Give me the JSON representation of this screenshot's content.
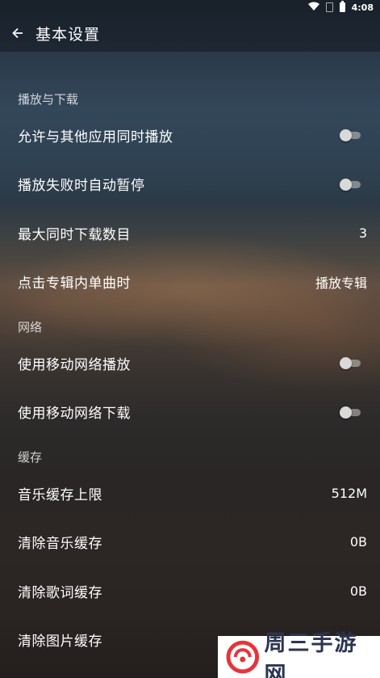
{
  "status_bar": {
    "time": "4:08"
  },
  "app_bar": {
    "title": "基本设置"
  },
  "sections": {
    "playback": {
      "header": "播放与下载",
      "allow_simultaneous": "允许与其他应用同时播放",
      "pause_on_fail": "播放失败时自动暂停",
      "max_downloads_label": "最大同时下载数目",
      "max_downloads_value": "3",
      "click_song_label": "点击专辑内单曲时",
      "click_song_value": "播放专辑"
    },
    "network": {
      "header": "网络",
      "mobile_play": "使用移动网络播放",
      "mobile_download": "使用移动网络下载"
    },
    "cache": {
      "header": "缓存",
      "music_cache_limit_label": "音乐缓存上限",
      "music_cache_limit_value": "512M",
      "clear_music_label": "清除音乐缓存",
      "clear_music_value": "0B",
      "clear_lyrics_label": "清除歌词缓存",
      "clear_lyrics_value": "0B",
      "clear_images_label": "清除图片缓存"
    }
  },
  "toggles": {
    "allow_simultaneous": false,
    "pause_on_fail": false,
    "mobile_play": false,
    "mobile_download": false
  },
  "watermark": {
    "text": "周三手游网"
  },
  "colors": {
    "logo_red": "#e8333a",
    "watermark_text": "#2b3550"
  }
}
